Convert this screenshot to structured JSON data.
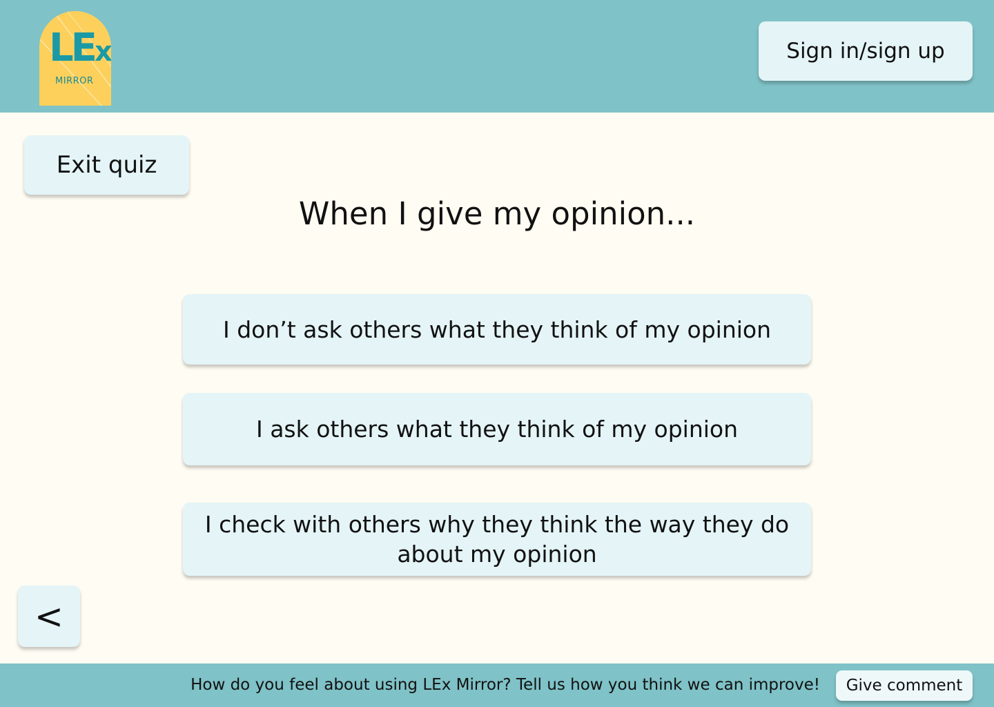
{
  "header": {
    "logo": {
      "main": "LE",
      "x": "x",
      "sub": "MIRROR"
    },
    "signin_label": "Sign in/sign up"
  },
  "quiz": {
    "exit_label": "Exit quiz",
    "question": "When I give my opinion...",
    "answers": [
      "I don’t ask others what they think of my opinion",
      "I ask others what they think of my opinion",
      "I check with others why they think the way they do about my opinion"
    ],
    "back_label": "<"
  },
  "footer": {
    "text": "How do you feel about using LEx Mirror? Tell us how you think we can improve!",
    "comment_label": "Give comment"
  },
  "colors": {
    "header_bg": "#7fc2c7",
    "page_bg": "#fffcf3",
    "button_bg": "#e4f4f7",
    "logo_bg": "#fdd05c",
    "logo_text": "#1b9aa5"
  }
}
